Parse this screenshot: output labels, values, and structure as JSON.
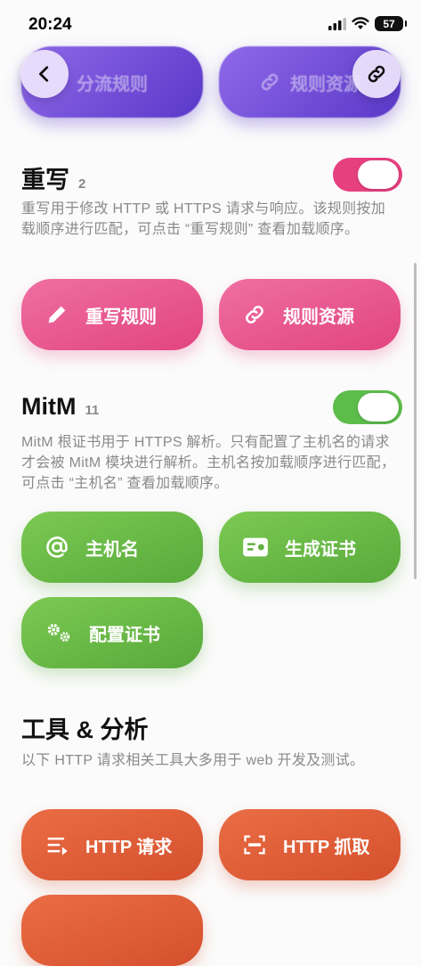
{
  "status": {
    "time": "20:24",
    "battery": "57"
  },
  "top_buttons": {
    "left_label": "分流规则",
    "right_label": "规则资源"
  },
  "rewrite": {
    "title": "重写",
    "count": "2",
    "description": "重写用于修改 HTTP 或 HTTPS 请求与响应。该规则按加载顺序进行匹配，可点击 “重写规则” 查看加载顺序。",
    "enabled": true,
    "buttons": [
      {
        "label": "重写规则",
        "icon": "pencil-icon"
      },
      {
        "label": "规则资源",
        "icon": "link-icon"
      }
    ]
  },
  "mitm": {
    "title": "MitM",
    "count": "11",
    "description": "MitM 根证书用于 HTTPS 解析。只有配置了主机名的请求才会被 MitM 模块进行解析。主机名按加载顺序进行匹配，可点击 “主机名” 查看加载顺序。",
    "enabled": true,
    "buttons": [
      {
        "label": "主机名",
        "icon": "at-icon"
      },
      {
        "label": "生成证书",
        "icon": "certificate-icon"
      },
      {
        "label": "配置证书",
        "icon": "gears-icon"
      }
    ]
  },
  "tools": {
    "title": "工具 & 分析",
    "description": "以下 HTTP 请求相关工具大多用于 web 开发及测试。",
    "buttons": [
      {
        "label": "HTTP 请求",
        "icon": "list-send-icon"
      },
      {
        "label": "HTTP 抓取",
        "icon": "http-capture-icon"
      }
    ]
  },
  "colors": {
    "pink": "#e6407f",
    "green": "#5cbd4b",
    "orange": "#d5502d",
    "purple": "#5a38c9"
  }
}
